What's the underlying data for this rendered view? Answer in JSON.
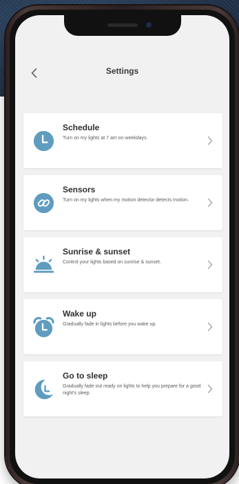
{
  "header": {
    "title": "Settings",
    "back_icon": "chevron-left-icon"
  },
  "colors": {
    "icon_blue": "#5f9cbf",
    "title_text": "#2f2f2f",
    "desc_text": "#5b5b5b",
    "screen_bg": "#f1f1f1",
    "card_bg": "#ffffff"
  },
  "settings": [
    {
      "title": "Schedule",
      "description": "Turn on my lights at 7 am on weekdays.",
      "icon": "clock-icon"
    },
    {
      "title": "Sensors",
      "description": "Turn on my lights when my motion detector detects motion.",
      "icon": "link-icon"
    },
    {
      "title": "Sunrise & sunset",
      "description": "Control your lights based on sunrise & sunset.",
      "icon": "sunrise-icon"
    },
    {
      "title": "Wake up",
      "description": "Gradually fade in lights before you wake up.",
      "icon": "alarm-clock-icon"
    },
    {
      "title": "Go to sleep",
      "description": "Gradually fade out ready on lights to help you prepare for a good night's sleep.",
      "icon": "moon-clock-icon"
    }
  ]
}
